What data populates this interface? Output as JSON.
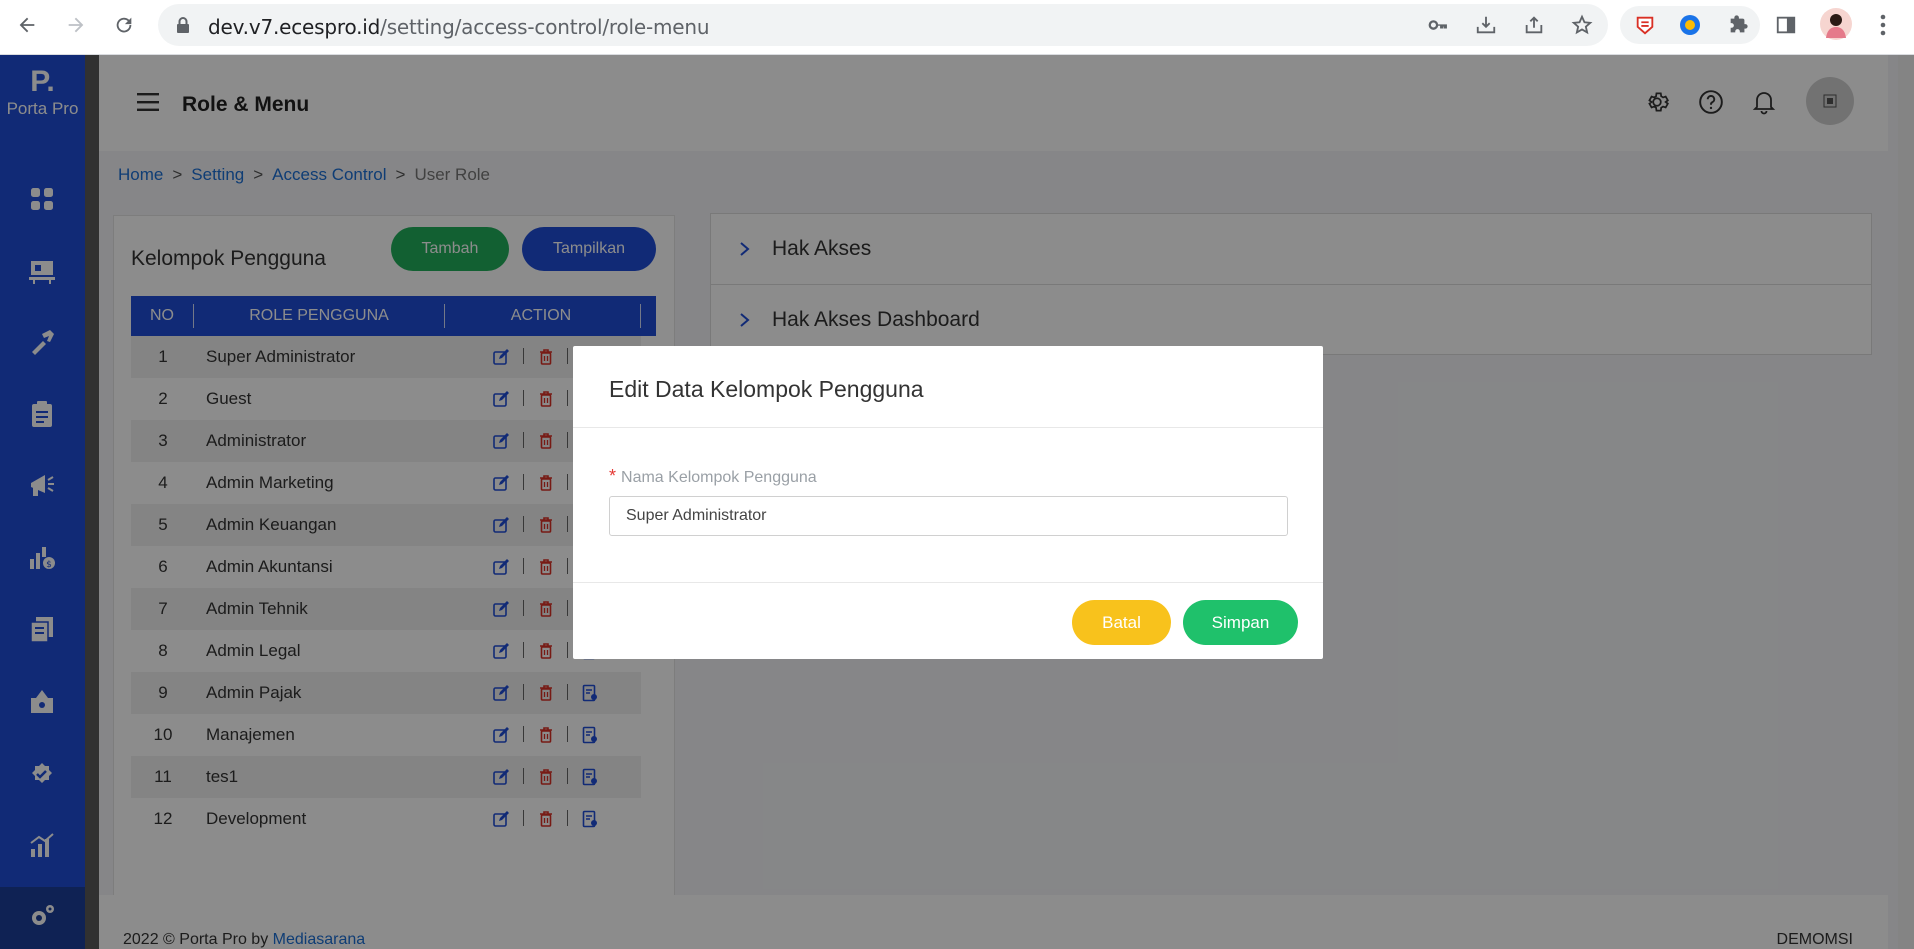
{
  "browser": {
    "url_host": "dev.v7.ecespro.id",
    "url_path": "/setting/access-control/role-menu"
  },
  "sidebar": {
    "logo_mark": "P.",
    "logo_text": "Porta Pro",
    "icons": [
      "dashboard-icon",
      "assets-icon",
      "tools-icon",
      "clipboard-icon",
      "marketing-icon",
      "finance-icon",
      "documents-icon",
      "projects-icon",
      "approval-icon",
      "report-icon",
      "settings-icon"
    ]
  },
  "header": {
    "title": "Role & Menu"
  },
  "breadcrumb": [
    "Home",
    "Setting",
    "Access Control",
    "User Role"
  ],
  "breadcrumb_sep": ">",
  "left_card": {
    "title": "Kelompok Pengguna",
    "add_label": "Tambah",
    "show_label": "Tampilkan",
    "columns": [
      "NO",
      "ROLE PENGGUNA",
      "ACTION"
    ],
    "rows": [
      {
        "no": "1",
        "role": "Super Administrator"
      },
      {
        "no": "2",
        "role": "Guest"
      },
      {
        "no": "3",
        "role": "Administrator"
      },
      {
        "no": "4",
        "role": "Admin Marketing"
      },
      {
        "no": "5",
        "role": "Admin Keuangan"
      },
      {
        "no": "6",
        "role": "Admin Akuntansi"
      },
      {
        "no": "7",
        "role": "Admin Tehnik"
      },
      {
        "no": "8",
        "role": "Admin Legal"
      },
      {
        "no": "9",
        "role": "Admin Pajak"
      },
      {
        "no": "10",
        "role": "Manajemen"
      },
      {
        "no": "11",
        "role": "tes1"
      },
      {
        "no": "12",
        "role": "Development"
      }
    ]
  },
  "right_panel": {
    "items": [
      "Hak Akses",
      "Hak Akses Dashboard"
    ]
  },
  "footer": {
    "copyright": "2022 © Porta Pro  by ",
    "company_link": "Mediasarana",
    "right_text": "DEMOMSI"
  },
  "modal": {
    "title": "Edit Data Kelompok Pengguna",
    "field_label": "Nama Kelompok Pengguna",
    "field_value": "Super Administrator",
    "cancel_label": "Batal",
    "save_label": "Simpan"
  },
  "colors": {
    "sidebar": "#1f4ed8",
    "tambah": "#22b05b",
    "tampilkan": "#1f4ed8",
    "batal": "#f8c21c",
    "simpan": "#1fc16b"
  }
}
